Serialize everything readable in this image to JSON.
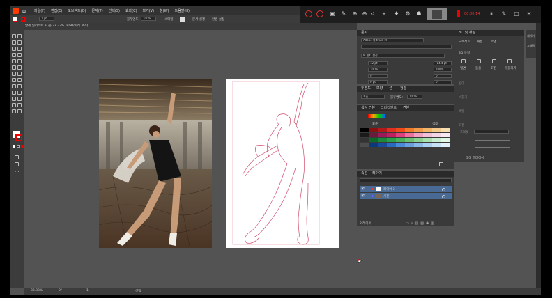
{
  "menu": {
    "items": [
      "파일(F)",
      "편집(E)",
      "오브젝트(O)",
      "문자(T)",
      "선택(S)",
      "효과(C)",
      "보기(V)",
      "창(W)",
      "도움말(H)"
    ]
  },
  "recorder": {
    "timer": "00:00:14",
    "label": "x1"
  },
  "control": {
    "stroke_weight": "1 pt",
    "opacity_label": "불투명도:",
    "opacity": "100%",
    "style_label": "스타일:",
    "ref_label": "문서 설정",
    "pref_label": "환경 설정"
  },
  "document": {
    "tab_title": "발레 일러스트.ai @ 33.33% (RGB/미리 보기)"
  },
  "status": {
    "zoom": "33.33%",
    "rotation": "0°",
    "page": "1",
    "mode": "선택"
  },
  "char_panel": {
    "tab": "문자",
    "font": "Adobe 명조 Std M",
    "style": "M 한자 설정",
    "size": "12 pt",
    "leading": "(14.4 pt)",
    "scale_v": "100%",
    "scale_h": "100%",
    "tracking": "0",
    "kerning": "0",
    "baseline": "0 pt",
    "rotate": "0°"
  },
  "transparency_panel": {
    "tabs": [
      "투명도",
      "모양",
      "선",
      "정렬"
    ],
    "mode": "표준",
    "opacity_label": "불투명도:",
    "opacity": "100%"
  },
  "swatch_panel": {
    "tabs": [
      "색상 견본",
      "그라디언트",
      "견본"
    ],
    "col1": "표준",
    "col2": "색조",
    "colors": [
      "#000000",
      "#8a1111",
      "#b21a1a",
      "#e03020",
      "#f04a1a",
      "#f07a2a",
      "#f09a4a",
      "#f2b56a",
      "#f5c98a",
      "#f7ddb0",
      "#1a1a1a",
      "#6a1a3a",
      "#9a1a5a",
      "#c02060",
      "#e04080",
      "#f070a0",
      "#f0a0c0",
      "#f0c0d8",
      "#f3d6e6",
      "#f7e9f1",
      "#333333",
      "#0a6a2a",
      "#1a8a3a",
      "#2aa04a",
      "#4ab05a",
      "#6ac070",
      "#8ad090",
      "#aae0b0",
      "#c8ecd0",
      "#e2f6e6",
      "#4d4d4d",
      "#0a3a7a",
      "#1a4a9a",
      "#2a6ac0",
      "#4a8ad8",
      "#6aa0e0",
      "#8ab8e8",
      "#aacff0",
      "#c8e0f6",
      "#e2effa"
    ]
  },
  "layers_panel": {
    "tabs": [
      "속성",
      "레이어"
    ],
    "rows": [
      {
        "name": "레이어 2"
      },
      {
        "name": "사진"
      }
    ],
    "footer": "2 레이어"
  },
  "threed_panel": {
    "tabs": [
      "3D 및 재질"
    ],
    "subtabs": [
      "오브젝트",
      "재질",
      "조명"
    ],
    "section": "3D 유형",
    "types": [
      "평면",
      "돌출",
      "회전",
      "부풀리기"
    ],
    "labels": [
      "깊이",
      "비틀기",
      "베벨",
      "회전"
    ],
    "preset_label": "프리셋",
    "footer": "레이 트레이싱"
  },
  "right_dock": {
    "items": [
      "레이어",
      "그래픽"
    ]
  }
}
